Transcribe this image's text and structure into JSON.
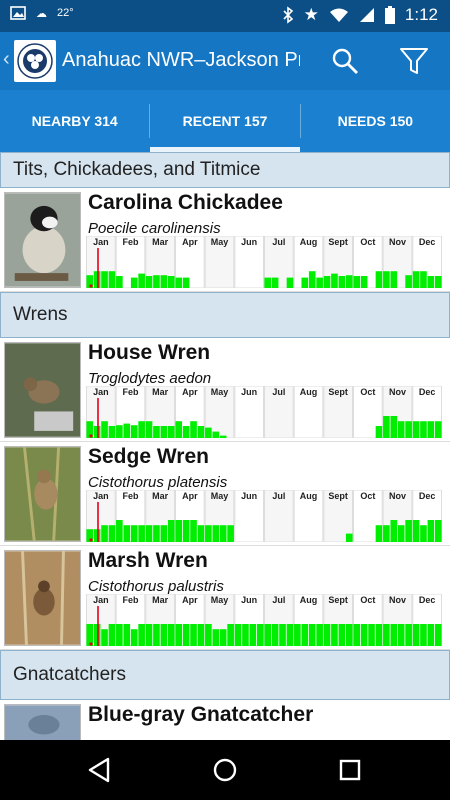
{
  "status": {
    "temperature": "22°",
    "time": "1:12",
    "icons": [
      "image-icon",
      "weather-icon",
      "bluetooth-icon",
      "star-icon",
      "wifi-icon",
      "signal-icon",
      "battery-icon"
    ]
  },
  "appbar": {
    "title": "Anahuac NWR–Jackson Pra",
    "logo_text": "Friends of Anahuac Refuge"
  },
  "tabs": [
    {
      "label": "NEARBY 314",
      "active": false
    },
    {
      "label": "RECENT 157",
      "active": true
    },
    {
      "label": "NEEDS 150",
      "active": false
    }
  ],
  "colors": {
    "bar": "#00ee00",
    "marker": "#e8001c",
    "header": "#1576c4",
    "section_bg": "#d6e4ef"
  },
  "months": [
    "Jan",
    "Feb",
    "Mar",
    "Apr",
    "May",
    "Jun",
    "Jul",
    "Aug",
    "Sept",
    "Oct",
    "Nov",
    "Dec"
  ],
  "sections": [
    {
      "title": "Tits, Chickadees, and Titmice",
      "species": [
        {
          "name": "Carolina Chickadee",
          "sci": "Poecile carolinensis",
          "freq": [
            0.32,
            0.42,
            0.42,
            0.42,
            0.3,
            0,
            0.26,
            0.36,
            0.3,
            0.32,
            0.32,
            0.3,
            0.26,
            0.26,
            0,
            0,
            0,
            0,
            0,
            0,
            0,
            0,
            0,
            0,
            0.26,
            0.26,
            0,
            0.26,
            0,
            0.26,
            0.42,
            0.26,
            0.3,
            0.36,
            0.3,
            0.32,
            0.3,
            0.3,
            0,
            0.42,
            0.42,
            0.42,
            0,
            0.32,
            0.42,
            0.42,
            0.3,
            0.3
          ]
        }
      ]
    },
    {
      "title": "Wrens",
      "species": [
        {
          "name": "House Wren",
          "sci": "Troglodytes aedon",
          "freq": [
            0.42,
            0.3,
            0.42,
            0.3,
            0.32,
            0.36,
            0.32,
            0.42,
            0.42,
            0.3,
            0.3,
            0.3,
            0.42,
            0.3,
            0.42,
            0.3,
            0.26,
            0.16,
            0.06,
            0,
            0,
            0,
            0,
            0,
            0,
            0,
            0,
            0,
            0,
            0,
            0,
            0,
            0,
            0,
            0,
            0,
            0,
            0,
            0,
            0.3,
            0.55,
            0.55,
            0.42,
            0.42,
            0.42,
            0.42,
            0.42,
            0.42
          ]
        },
        {
          "name": "Sedge Wren",
          "sci": "Cistothorus platensis",
          "freq": [
            0.32,
            0.32,
            0.42,
            0.42,
            0.55,
            0.42,
            0.42,
            0.42,
            0.42,
            0.42,
            0.42,
            0.55,
            0.55,
            0.55,
            0.55,
            0.42,
            0.42,
            0.42,
            0.42,
            0.42,
            0,
            0,
            0,
            0,
            0,
            0,
            0,
            0,
            0,
            0,
            0,
            0,
            0,
            0,
            0,
            0.21,
            0,
            0,
            0,
            0.42,
            0.42,
            0.55,
            0.42,
            0.55,
            0.55,
            0.42,
            0.55,
            0.55
          ]
        },
        {
          "name": "Marsh Wren",
          "sci": "Cistothorus palustris",
          "freq": [
            0.55,
            0.55,
            0.42,
            0.55,
            0.55,
            0.55,
            0.42,
            0.55,
            0.55,
            0.55,
            0.55,
            0.55,
            0.55,
            0.55,
            0.55,
            0.55,
            0.55,
            0.42,
            0.42,
            0.55,
            0.55,
            0.55,
            0.55,
            0.55,
            0.55,
            0.55,
            0.55,
            0.55,
            0.55,
            0.55,
            0.55,
            0.55,
            0.55,
            0.55,
            0.55,
            0.55,
            0.55,
            0.55,
            0.55,
            0.55,
            0.55,
            0.55,
            0.55,
            0.55,
            0.55,
            0.55,
            0.55,
            0.55
          ]
        }
      ]
    },
    {
      "title": "Gnatcatchers",
      "species": [
        {
          "name": "Blue-gray Gnatcatcher",
          "sci": "",
          "freq": []
        }
      ]
    }
  ]
}
